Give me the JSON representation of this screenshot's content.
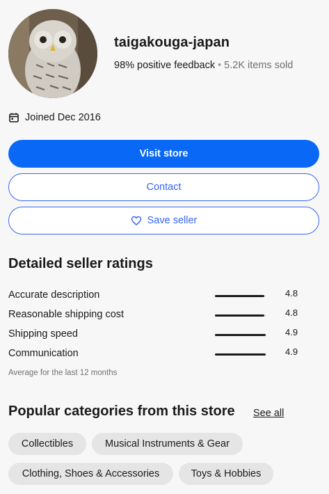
{
  "seller": {
    "name": "taigakouga-japan",
    "feedback": "98% positive feedback",
    "separator": "•",
    "items_sold": "5.2K items sold",
    "joined": "Joined Dec 2016"
  },
  "actions": {
    "visit_store": "Visit store",
    "contact": "Contact",
    "save_seller": "Save seller"
  },
  "ratings": {
    "title": "Detailed seller ratings",
    "items": [
      {
        "label": "Accurate description",
        "value": "4.8",
        "fraction": 0.96
      },
      {
        "label": "Reasonable shipping cost",
        "value": "4.8",
        "fraction": 0.96
      },
      {
        "label": "Shipping speed",
        "value": "4.9",
        "fraction": 0.98
      },
      {
        "label": "Communication",
        "value": "4.9",
        "fraction": 0.98
      }
    ],
    "note": "Average for the last 12 months"
  },
  "categories": {
    "title": "Popular categories from this store",
    "see_all": "See all",
    "items": [
      "Collectibles",
      "Musical Instruments & Gear",
      "Clothing, Shoes & Accessories",
      "Toys & Hobbies"
    ]
  },
  "colors": {
    "primary": "#0968f6",
    "outline": "#3665f3",
    "chip": "#e5e5e5",
    "background": "#f7f7f7"
  },
  "icons": {
    "calendar": "calendar-icon",
    "heart": "heart-icon"
  }
}
